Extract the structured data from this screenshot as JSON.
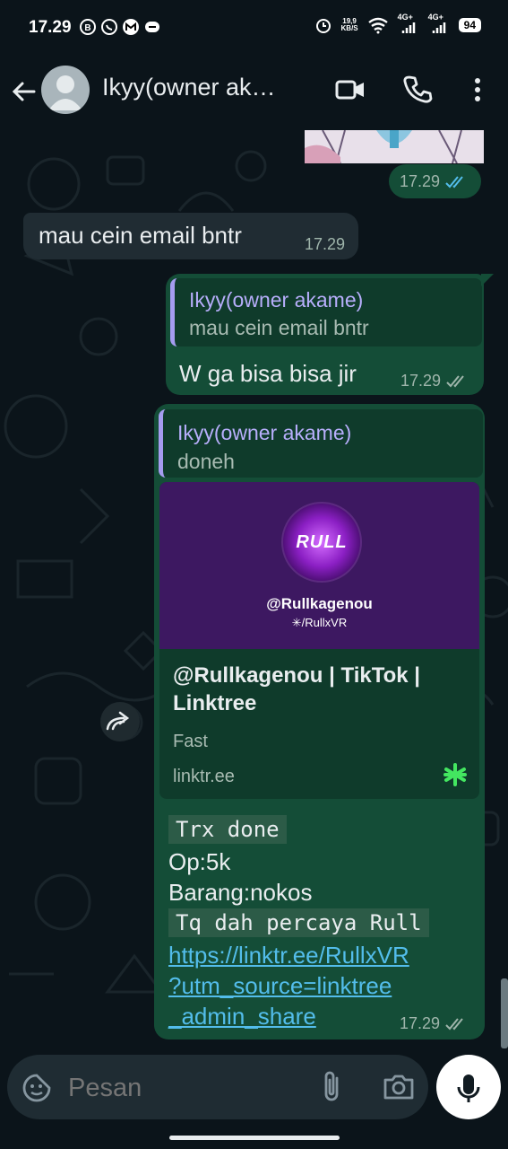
{
  "status_bar": {
    "time": "17.29",
    "net_speed_value": "19,9",
    "net_speed_unit": "KB/S",
    "signal_1": "4G+",
    "signal_2": "4G+",
    "battery": "94"
  },
  "header": {
    "contact_name": "Ikyy(owner ak…"
  },
  "messages": [
    {
      "time": "17.29"
    },
    {
      "text": "mau cein email bntr",
      "time": "17.29"
    },
    {
      "quote_name": "Ikyy(owner akame)",
      "quote_text": "mau cein email bntr",
      "text": "W ga bisa bisa jir",
      "time": "17.29"
    },
    {
      "quote_name": "Ikyy(owner akame)",
      "quote_text": "doneh",
      "link_preview": {
        "handle": "@Rullkagenou",
        "subhandle": "✳/RullxVR",
        "logo_text": "RULL",
        "title": "@Rullkagenou | TikTok | Linktree",
        "description": "Fast",
        "domain": "linktr.ee"
      },
      "line_1": "Trx done",
      "line_2": "Op:5k",
      "line_3": "Barang:nokos",
      "line_4": "Tq dah percaya Rull",
      "url_1": "https://linktr.ee/RullxVR",
      "url_2": "?utm_source=linktree",
      "url_3": "_admin_share",
      "time": "17.29"
    }
  ],
  "composer": {
    "placeholder": "Pesan"
  },
  "colors": {
    "background": "#0b141a",
    "outgoing_bubble": "#144d37",
    "incoming_bubble": "#202c33",
    "link": "#53bdeb",
    "read_ticks": "#53bdeb"
  }
}
